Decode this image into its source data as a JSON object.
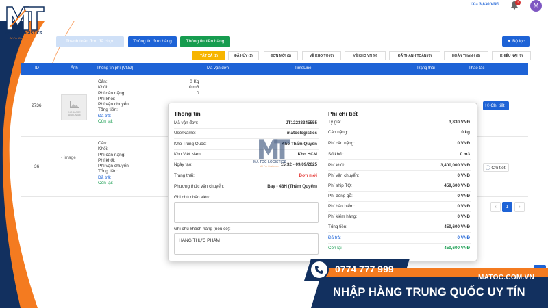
{
  "header": {
    "exchange_rate": "1¥ = 3,830 VNĐ",
    "notification_count": "1",
    "avatar_letter": "M"
  },
  "brand": {
    "name": "MA TOC LOGISTICS",
    "slogan": "All For Customers"
  },
  "actions": {
    "payment_label": "Thanh toán đơn đã chọn",
    "order_info_label": "Thông tin đơn hàng",
    "money_info_label": "Thông tin tiền hàng",
    "filter_label": "Bộ lọc"
  },
  "tabs": [
    {
      "label": "TẤT CẢ",
      "count": "(2)"
    },
    {
      "label": "ĐÃ HỦY",
      "count": "(1)"
    },
    {
      "label": "ĐƠN MỚI",
      "count": "(1)"
    },
    {
      "label": "VỀ KHO TQ",
      "count": "(0)"
    },
    {
      "label": "VỀ KHO VN",
      "count": "(0)"
    },
    {
      "label": "ĐÃ THANH TOÁN",
      "count": "(0)"
    },
    {
      "label": "HOÀN THÀNH",
      "count": "(0)"
    },
    {
      "label": "KHIẾU NẠI",
      "count": "(0)"
    }
  ],
  "table": {
    "headers": {
      "id": "ID",
      "image": "Ảnh",
      "fee_info": "Thông tin phí (VNĐ)",
      "tracking": "Mã vận đơn",
      "timeline": "TimeLine",
      "status": "Trạng thái",
      "action": "Thao tác"
    },
    "fee_labels": [
      "Cân:",
      "Khối:",
      "Phí cân nặng:",
      "Phí khối:",
      "Phí vận chuyển:",
      "Tổng tiền:",
      "Đã trả:",
      "Còn lại:"
    ],
    "rows": [
      {
        "id": "2736",
        "no_image_text": "NO IMAGE AVAILABLE",
        "weight": "0 Kg",
        "volume": "0 m3",
        "weight_fee": "0",
        "detail_label": "Chi tiết"
      },
      {
        "id": "36",
        "image_alt": "image",
        "detail_label": "Chi tiết"
      }
    ]
  },
  "pagination": {
    "prev": "‹",
    "current": "1",
    "next": "›"
  },
  "modal": {
    "info_title": "Thông tin",
    "info": [
      {
        "label": "Mã vận đơn:",
        "value": "JT12233345555"
      },
      {
        "label": "UserName:",
        "value": "matoclogistics"
      },
      {
        "label": "Kho Trung Quốc:",
        "value": "Kho Thẩm Quyến"
      },
      {
        "label": "Kho Việt Nam:",
        "value": "Kho HCM"
      },
      {
        "label": "Ngày tạo:",
        "value": "15:32 - 09/09/2025"
      },
      {
        "label": "Trạng thái:",
        "value": "Đơn mới"
      },
      {
        "label": "Phương thức vận chuyển:",
        "value": "Bay - 48H (Thẩm Quyến)"
      }
    ],
    "staff_note_label": "Ghi chú nhân viên:",
    "customer_note_label": "Ghi chú khách hàng (nếu có):",
    "customer_note_value": "HÀNG THỰC PHẨM",
    "fee_title": "Phí chi tiết",
    "fees": [
      {
        "label": "Tỷ giá:",
        "value": "3,830 VNĐ"
      },
      {
        "label": "Cân nặng:",
        "value": "0 kg"
      },
      {
        "label": "Phí cân nặng:",
        "value": "0 VNĐ"
      },
      {
        "label": "Số khối:",
        "value": "0 m3"
      },
      {
        "label": "Phí khối:",
        "value": "3,400,000 VNĐ"
      },
      {
        "label": "Phí vận chuyển:",
        "value": "0 VNĐ"
      },
      {
        "label": "Phí ship TQ:",
        "value": "459,600 VNĐ"
      },
      {
        "label": "Phí đóng gỗ:",
        "value": "0 VNĐ"
      },
      {
        "label": "Phí bảo hiểm:",
        "value": "0 VNĐ"
      },
      {
        "label": "Phí kiểm hàng:",
        "value": "0 VNĐ"
      },
      {
        "label": "Tổng tiền:",
        "value": "459,600 VNĐ"
      },
      {
        "label": "Đã trả:",
        "value": "0 VNĐ"
      },
      {
        "label": "Còn lại:",
        "value": "459,600 VNĐ"
      }
    ]
  },
  "watermark": {
    "name": "MA TOC LOGISTICS",
    "slogan": "All For Customers"
  },
  "banner": {
    "phone": "0774 777 999",
    "site": "MATOC.COM.VN",
    "slogan": "NHẬP HÀNG TRUNG QUỐC UY TÍN"
  },
  "colors": {
    "primary": "#1e63d6",
    "orange": "#f47b20",
    "navy": "#12305f",
    "tab_active": "#f7b500",
    "green": "#169c4f",
    "red": "#e53935"
  }
}
